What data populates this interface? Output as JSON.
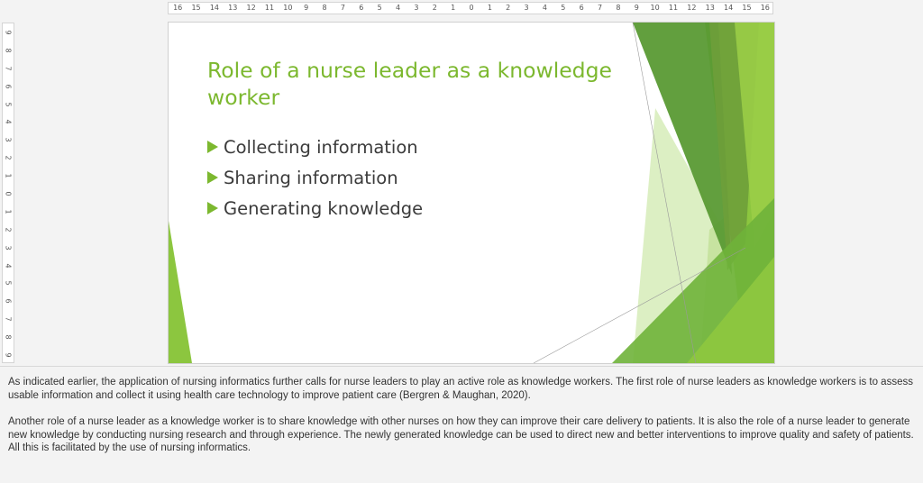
{
  "ruler": {
    "horizontal": [
      "16",
      "15",
      "14",
      "13",
      "12",
      "11",
      "10",
      "9",
      "8",
      "7",
      "6",
      "5",
      "4",
      "3",
      "2",
      "1",
      "0",
      "1",
      "2",
      "3",
      "4",
      "5",
      "6",
      "7",
      "8",
      "9",
      "10",
      "11",
      "12",
      "13",
      "14",
      "15",
      "16"
    ],
    "vertical": [
      "9",
      "8",
      "7",
      "6",
      "5",
      "4",
      "3",
      "2",
      "1",
      "0",
      "1",
      "2",
      "3",
      "4",
      "5",
      "6",
      "7",
      "8",
      "9"
    ]
  },
  "slide": {
    "title": "Role of a nurse leader as a knowledge worker",
    "bullets": [
      "Collecting information",
      "Sharing information",
      "Generating knowledge"
    ],
    "colors": {
      "accent": "#7cb82f",
      "dark_green": "#4e8a2a",
      "light_green": "#c7e59a",
      "text": "#3b3b3b"
    }
  },
  "notes": {
    "paragraphs": [
      "As indicated earlier, the application of nursing informatics further calls for nurse leaders to play an active role as knowledge workers. The first role of nurse leaders as knowledge workers is to assess usable information and collect it using health care technology to improve patient care (Bergren & Maughan, 2020).",
      "Another role of a nurse leader as a knowledge worker is to share knowledge with other nurses on how they can improve their care delivery to patients. It is also the role of a nurse leader to generate new knowledge by conducting nursing research and through experience. The newly generated knowledge can be used to direct new and better interventions to improve quality and safety of patients. All this is facilitated by the use of nursing informatics."
    ]
  }
}
